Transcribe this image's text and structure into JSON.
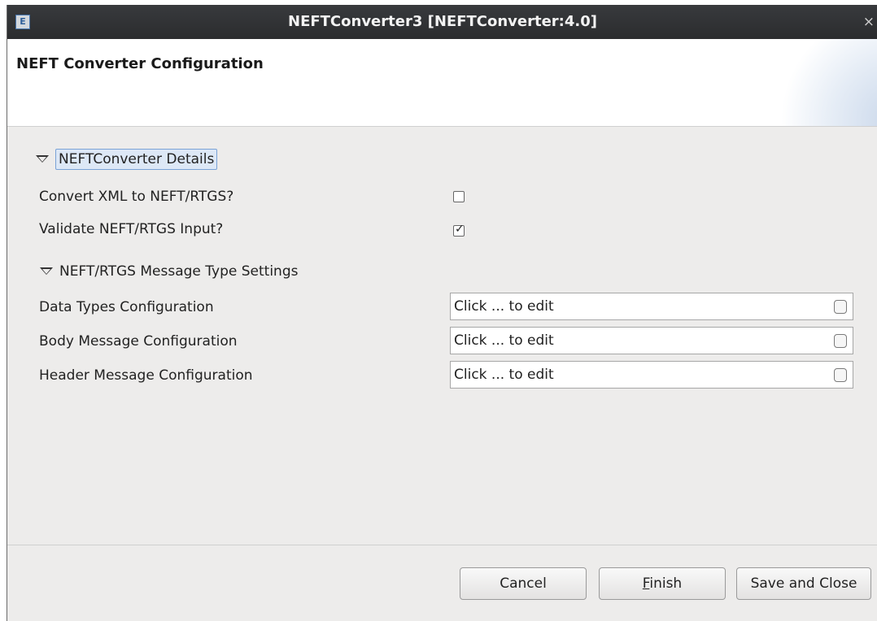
{
  "window": {
    "title": "NEFTConverter3 [NEFTConverter:4.0]",
    "app_icon": "E",
    "close": "×"
  },
  "banner": {
    "title": "NEFT Converter Configuration"
  },
  "details_section": {
    "label": "NEFTConverter Details",
    "rows": [
      {
        "label": "Convert XML to NEFT/RTGS?",
        "checked": false
      },
      {
        "label": "Validate NEFT/RTGS Input?",
        "checked": true,
        "check_glyph": "✓"
      }
    ]
  },
  "message_section": {
    "label": "NEFT/RTGS Message Type Settings",
    "rows": [
      {
        "label": "Data Types Configuration",
        "value": "Click ... to edit"
      },
      {
        "label": "Body Message Configuration",
        "value": "Click ... to edit"
      },
      {
        "label": "Header Message Configuration",
        "value": "Click ... to edit"
      }
    ]
  },
  "buttons": {
    "cancel": "Cancel",
    "finish_mnemonic": "F",
    "finish_rest": "inish",
    "save_close": "Save and Close"
  },
  "icons": {
    "expand": "triangle-down-icon",
    "field_edit": "ellipsis-button"
  },
  "colors": {
    "titlebar": "#2f3032",
    "dialog_bg": "#edeceb",
    "focus_border": "#7aa2d6"
  }
}
